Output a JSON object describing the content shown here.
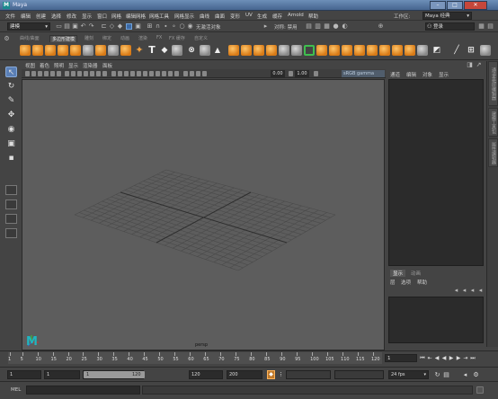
{
  "window": {
    "title": "Maya",
    "icon": "M"
  },
  "menubar": {
    "items": [
      "文件",
      "编辑",
      "创建",
      "选择",
      "修改",
      "显示",
      "窗口",
      "网格",
      "编辑网格",
      "网格工具",
      "网格显示",
      "曲线",
      "曲面",
      "变形",
      "UV",
      "生成",
      "缓存",
      "Arnold",
      "帮助"
    ],
    "workspace_label": "工作区:",
    "workspace_value": "Maya 经典"
  },
  "statusline": {
    "mode": "建模",
    "symmetry_label": "无激活对象",
    "live_label": "对称: 禁用",
    "search_value": "登录"
  },
  "shelf": {
    "tabs": [
      "曲线/曲面",
      "多边形建模",
      "雕刻",
      "绑定",
      "动画",
      "渲染",
      "FX",
      "FX 缓存",
      "自定义"
    ],
    "active_tab_index": 1
  },
  "toolbox": {
    "tools": [
      "select-tool",
      "lasso-tool",
      "paint-select-tool",
      "move-tool",
      "rotate-tool",
      "scale-tool",
      "last-tool"
    ]
  },
  "panel": {
    "menu": [
      "视图",
      "着色",
      "照明",
      "显示",
      "渲染器",
      "面板"
    ],
    "near_value": "0.00",
    "far_value": "1.00",
    "color_space": "sRGB gamma",
    "camera_label": "persp"
  },
  "channelbox": {
    "tabs_icons": [
      "channel-icon-1",
      "channel-icon-2",
      "channel-icon-3",
      "channel-icon-4"
    ],
    "menu": [
      "通道",
      "编辑",
      "对象",
      "显示"
    ]
  },
  "right_tabs": [
    "通道盒/层编辑器",
    "建模工具包",
    "属性编辑器"
  ],
  "layers": {
    "tabs": [
      "显示",
      "动画"
    ],
    "menu": [
      "层",
      "选项",
      "帮助"
    ]
  },
  "timeslider": {
    "ticks": [
      "1",
      "5",
      "10",
      "15",
      "20",
      "25",
      "30",
      "35",
      "40",
      "45",
      "50",
      "55",
      "60",
      "65",
      "70",
      "75",
      "80",
      "85",
      "90",
      "95",
      "100",
      "105",
      "110",
      "115",
      "120"
    ],
    "current_frame": "1"
  },
  "range": {
    "start": "1",
    "playback_start": "1",
    "slider_start": "1",
    "slider_end": "120",
    "playback_end": "120",
    "end": "200",
    "fps": "24 fps"
  },
  "commandline": {
    "label": "MEL"
  },
  "colors": {
    "accent": "#5a7fb6",
    "shelf_orange": "#e08a22",
    "maya_logo": "#1fb6c0"
  }
}
